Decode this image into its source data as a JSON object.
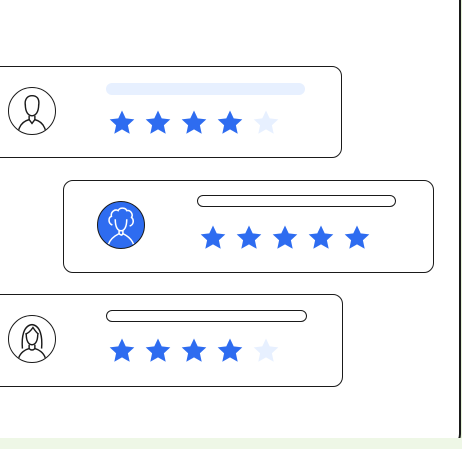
{
  "colors": {
    "accent": "#2e6cf0",
    "star_empty": "#e7f0ff",
    "outline": "#1a1a1a",
    "placeholder_bar": "#e7f0ff",
    "frame_shadow": "#e3f1d6"
  },
  "reviews": [
    {
      "avatar_icon": "man-avatar-icon",
      "rating": 4,
      "max_rating": 5
    },
    {
      "avatar_icon": "woman-curly-avatar-icon",
      "rating": 5,
      "max_rating": 5
    },
    {
      "avatar_icon": "woman-avatar-icon",
      "rating": 4,
      "max_rating": 5
    }
  ]
}
